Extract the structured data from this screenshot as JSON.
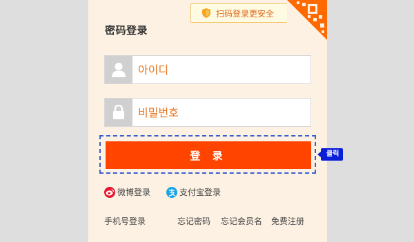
{
  "scan_tip": {
    "label": "扫码登录更安全"
  },
  "title": "密码登录",
  "username": {
    "placeholder": "아이디"
  },
  "password": {
    "placeholder": "비밀번호"
  },
  "login_button": "登 录",
  "click_tag": "클릭",
  "social": {
    "weibo": "微博登录",
    "alipay": "支付宝登录"
  },
  "footer": {
    "phone_login": "手机号登录",
    "forgot_password": "忘记密码",
    "forgot_member": "忘记会员名",
    "register": "免费注册"
  },
  "colors": {
    "accent": "#ff4400",
    "panel_bg": "#fdf1e3",
    "tag_blue": "#0a1fd8"
  },
  "icons": {
    "scan_tip": "shield-icon",
    "qr": "qr-code-icon",
    "username": "user-icon",
    "password": "lock-icon",
    "weibo": "weibo-icon",
    "alipay": "alipay-icon"
  }
}
